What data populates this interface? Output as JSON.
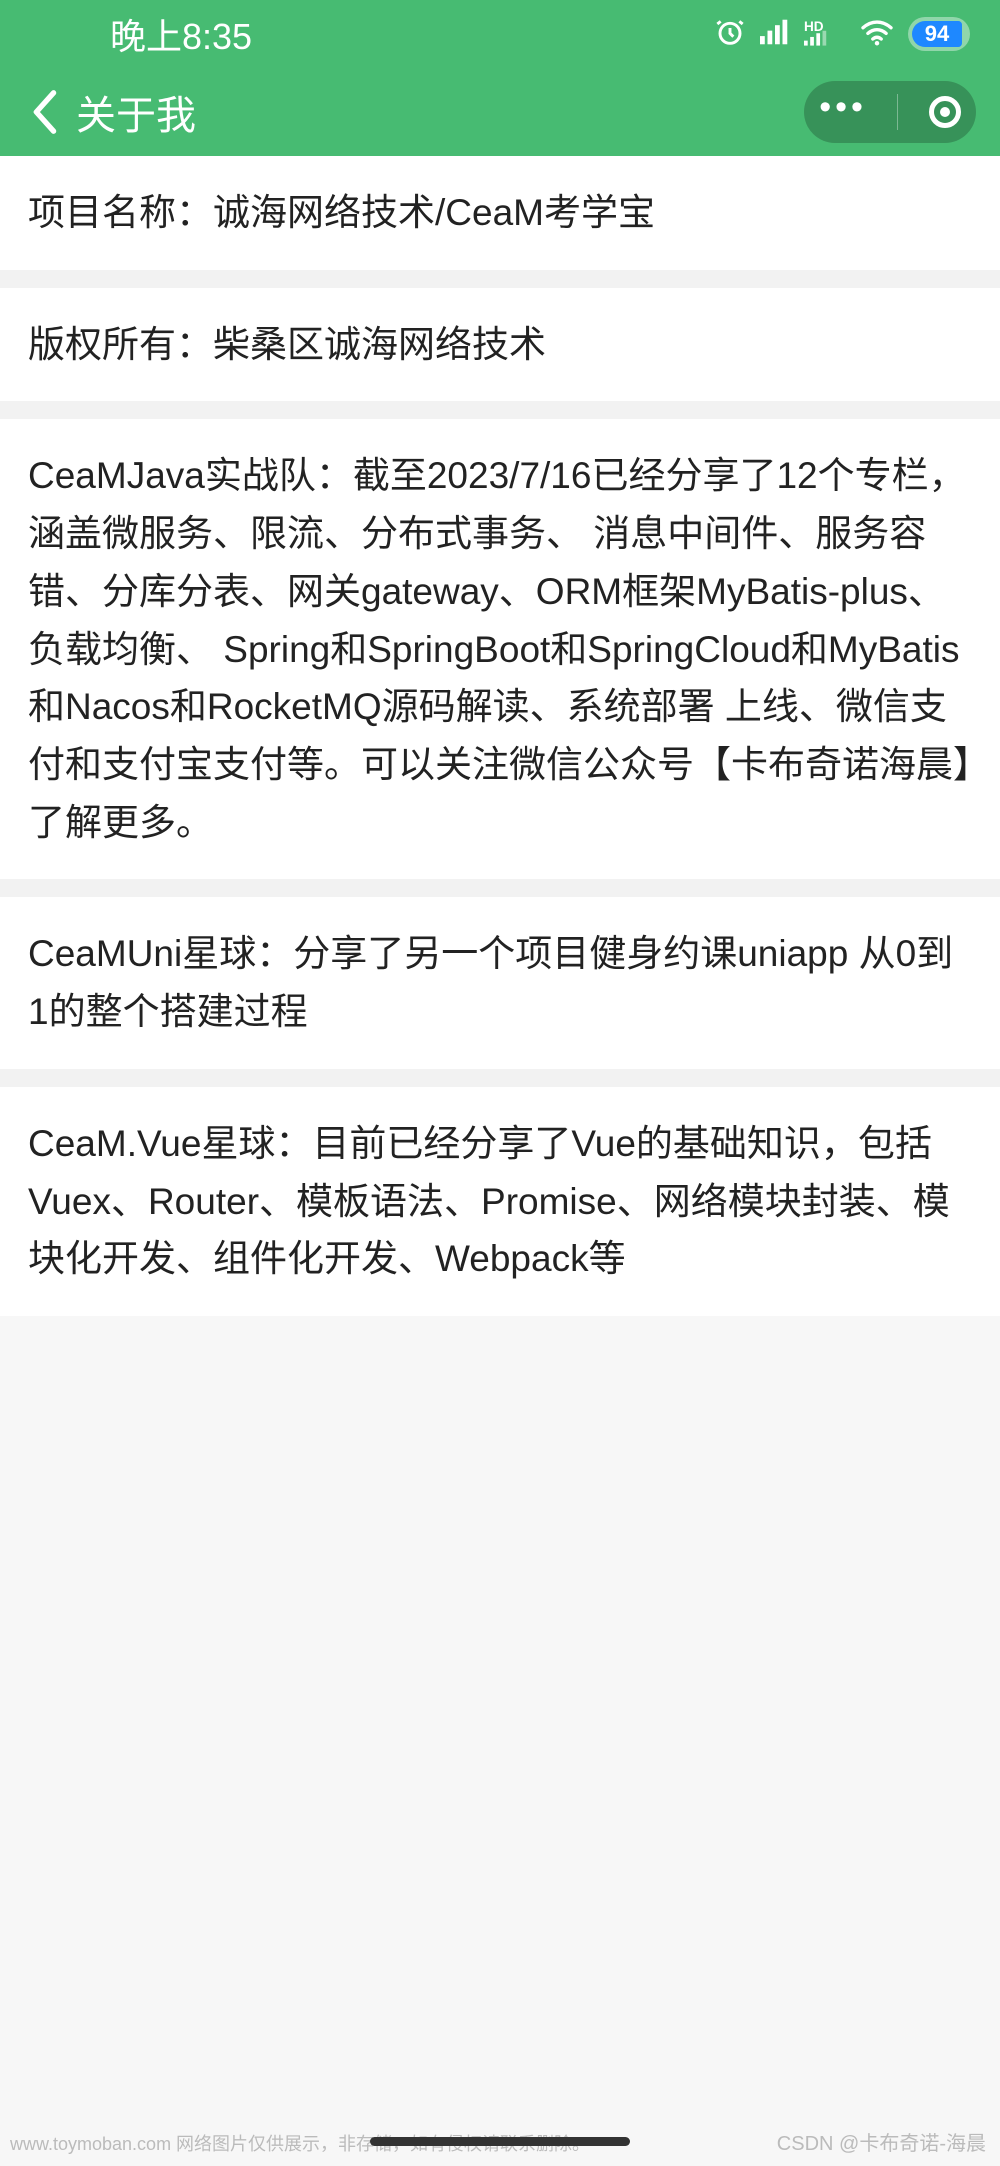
{
  "status": {
    "time": "晚上8:35",
    "battery_percent": "94"
  },
  "nav": {
    "title": "关于我"
  },
  "cards": [
    {
      "text": "项目名称：诚海网络技术/CeaM考学宝"
    },
    {
      "text": "版权所有：柴桑区诚海网络技术"
    },
    {
      "text": "CeaMJava实战队：截至2023/7/16已经分享了12个专栏，涵盖微服务、限流、分布式事务、 消息中间件、服务容错、分库分表、网关gateway、ORM框架MyBatis-plus、负载均衡、 Spring和SpringBoot和SpringCloud和MyBatis和Nacos和RocketMQ源码解读、系统部署 上线、微信支付和支付宝支付等。可以关注微信公众号【卡布奇诺海晨】了解更多。"
    },
    {
      "text": "CeaMUni星球：分享了另一个项目健身约课uniapp 从0到1的整个搭建过程"
    },
    {
      "text": "CeaM.Vue星球：目前已经分享了Vue的基础知识，包括Vuex、Router、模板语法、Promise、网络模块封装、模块化开发、组件化开发、Webpack等"
    }
  ],
  "watermark": {
    "left": "www.toymoban.com 网络图片仅供展示，非存储，如有侵权请联系删除。",
    "right": "CSDN @卡布奇诺-海晨"
  }
}
